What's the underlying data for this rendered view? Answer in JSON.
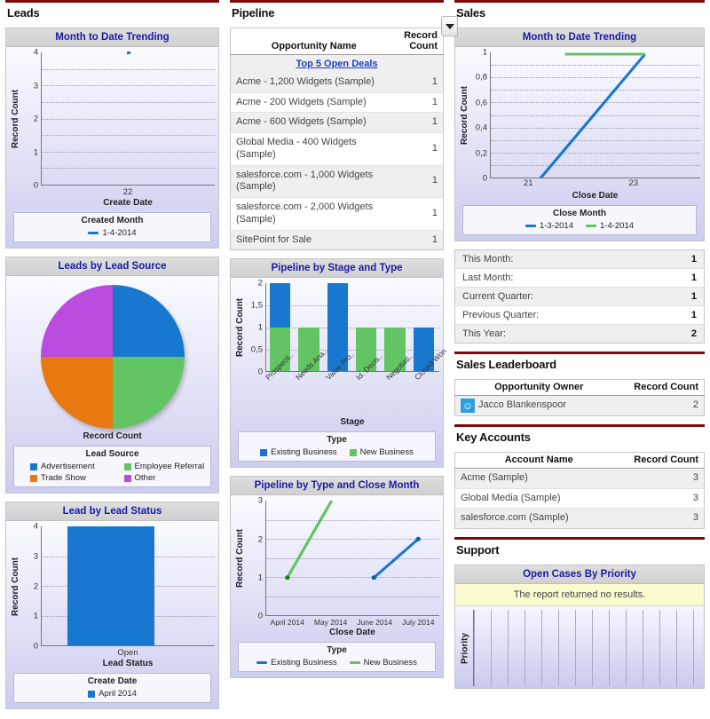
{
  "sections": {
    "leads": {
      "title": "Leads"
    },
    "pipeline": {
      "title": "Pipeline"
    },
    "sales": {
      "title": "Sales"
    },
    "leaderboard": {
      "title": "Sales Leaderboard"
    },
    "key_accounts": {
      "title": "Key Accounts"
    },
    "support": {
      "title": "Support"
    }
  },
  "colors": {
    "accent_red": "#7c0a0a",
    "title_blue": "#1a1aa8",
    "link_blue": "#1a3fc4",
    "series_blue": "#1878d0",
    "series_green": "#62c462",
    "series_orange": "#e8780f",
    "series_purple": "#bb4ce0"
  },
  "components": {
    "leads_mtd": {
      "title": "Month to Date Trending",
      "legend_title": "Created Month",
      "ylabel": "Record Count",
      "xlabel": "Create Date"
    },
    "leads_source": {
      "title": "Leads by Lead Source",
      "caption": "Record Count",
      "legend_title": "Lead Source"
    },
    "leads_status": {
      "title": "Lead by Lead Status",
      "legend_title": "Create Date",
      "ylabel": "Record Count",
      "xlabel": "Lead Status"
    },
    "top_deals": {
      "link_label": "Top 5 Open Deals",
      "columns": [
        "Opportunity Name",
        "Record Count"
      ]
    },
    "pipeline_stage": {
      "title": "Pipeline by Stage and Type",
      "legend_title": "Type",
      "ylabel": "Record Count",
      "xlabel": "Stage"
    },
    "pipeline_close": {
      "title": "Pipeline by Type and Close Month",
      "legend_title": "Type",
      "ylabel": "Record Count",
      "xlabel": "Close Date"
    },
    "sales_mtd": {
      "title": "Month to Date Trending",
      "legend_title": "Close Month",
      "ylabel": "Record Count",
      "xlabel": "Close Date"
    },
    "sales_metrics": {
      "rows": [
        {
          "label": "This Month:",
          "value": "1"
        },
        {
          "label": "Last Month:",
          "value": "1"
        },
        {
          "label": "Current Quarter:",
          "value": "1"
        },
        {
          "label": "Previous Quarter:",
          "value": "1"
        },
        {
          "label": "This Year:",
          "value": "2"
        }
      ]
    },
    "leaderboard": {
      "columns": [
        "Opportunity Owner",
        "Record Count"
      ],
      "rows": [
        {
          "owner": "Jacco Blankenspoor",
          "count": "2",
          "avatar_icon": "smiley-avatar-icon"
        }
      ]
    },
    "key_accounts": {
      "columns": [
        "Account Name",
        "Record Count"
      ],
      "rows": [
        {
          "name": "Acme (Sample)",
          "count": "3"
        },
        {
          "name": "Global Media (Sample)",
          "count": "3"
        },
        {
          "name": "salesforce.com (Sample)",
          "count": "3"
        }
      ]
    },
    "support": {
      "title": "Open Cases By Priority",
      "notice": "The report returned no results.",
      "ylabel": "Priority"
    }
  },
  "chart_data": [
    {
      "id": "leads_mtd",
      "type": "scatter",
      "title": "Month to Date Trending",
      "xlabel": "Create Date",
      "ylabel": "Record Count",
      "yticks": [
        "4",
        "3",
        "2",
        "1",
        "0"
      ],
      "ylim": [
        0,
        4
      ],
      "xticks": [
        "22"
      ],
      "grid": true,
      "legend_title": "Created Month",
      "legend_position": "bottom",
      "series": [
        {
          "name": "1-4-2014",
          "color": "#1878d0",
          "x": [
            22
          ],
          "values": [
            4
          ]
        }
      ]
    },
    {
      "id": "leads_source",
      "type": "pie",
      "title": "Leads by Lead Source",
      "caption": "Record Count",
      "legend_title": "Lead Source",
      "legend_position": "bottom",
      "labels": [
        "Advertisement",
        "Employee Referral",
        "Trade Show",
        "Other"
      ],
      "values": [
        1,
        1,
        1,
        1
      ],
      "percents": [
        25,
        25,
        25,
        25
      ],
      "colors": [
        "#1878d0",
        "#62c462",
        "#e8780f",
        "#bb4ce0"
      ]
    },
    {
      "id": "leads_status",
      "type": "bar",
      "title": "Lead by Lead Status",
      "xlabel": "Lead Status",
      "ylabel": "Record Count",
      "yticks": [
        "4",
        "3",
        "2",
        "1",
        "0"
      ],
      "ylim": [
        0,
        4
      ],
      "categories": [
        "Open"
      ],
      "grid": true,
      "legend_title": "Create Date",
      "legend_position": "bottom",
      "series": [
        {
          "name": "April 2014",
          "color": "#1878d0",
          "values": [
            4
          ]
        }
      ]
    },
    {
      "id": "top_deals",
      "type": "table",
      "title": "Top 5 Open Deals",
      "columns": [
        "Opportunity Name",
        "Record Count"
      ],
      "rows": [
        [
          "Acme - 1,200 Widgets (Sample)",
          "1"
        ],
        [
          "Acme - 200 Widgets (Sample)",
          "1"
        ],
        [
          "Acme - 600 Widgets (Sample)",
          "1"
        ],
        [
          "Global Media - 400 Widgets (Sample)",
          "1"
        ],
        [
          "salesforce.com - 1,000 Widgets (Sample)",
          "1"
        ],
        [
          "salesforce.com - 2,000 Widgets (Sample)",
          "1"
        ],
        [
          "SitePoint for Sale",
          "1"
        ]
      ]
    },
    {
      "id": "pipeline_stage",
      "type": "bar",
      "stacked": true,
      "title": "Pipeline by Stage and Type",
      "xlabel": "Stage",
      "ylabel": "Record Count",
      "yticks": [
        "2",
        "1,5",
        "1",
        "0,5",
        "0"
      ],
      "ylim": [
        0,
        2
      ],
      "grid": true,
      "categories": [
        "Prospecti..",
        "Needs Ana..",
        "Value Pro..",
        "Id. Decis..",
        "Negotiati..",
        "Closed Won"
      ],
      "legend_title": "Type",
      "legend_position": "bottom",
      "series": [
        {
          "name": "Existing Business",
          "color": "#1878d0",
          "values": [
            1,
            0,
            2,
            0,
            0,
            1
          ]
        },
        {
          "name": "New Business",
          "color": "#62c462",
          "values": [
            1,
            1,
            0,
            1,
            1,
            0
          ]
        }
      ]
    },
    {
      "id": "pipeline_close",
      "type": "line",
      "title": "Pipeline by Type and Close Month",
      "xlabel": "Close Date",
      "ylabel": "Record Count",
      "yticks": [
        "3",
        "2",
        "1",
        "0"
      ],
      "ylim": [
        0,
        3
      ],
      "grid": true,
      "categories": [
        "April 2014",
        "May 2014",
        "June 2014",
        "July 2014"
      ],
      "legend_title": "Type",
      "legend_position": "bottom",
      "series": [
        {
          "name": "Existing Business",
          "color": "#1878d0",
          "points": [
            [
              "June 2014",
              1
            ],
            [
              "July 2014",
              2
            ]
          ]
        },
        {
          "name": "New Business",
          "color": "#62c462",
          "points": [
            [
              "April 2014",
              1
            ],
            [
              "May 2014",
              3
            ]
          ]
        }
      ]
    },
    {
      "id": "sales_mtd",
      "type": "line",
      "title": "Month to Date Trending",
      "xlabel": "Close Date",
      "ylabel": "Record Count",
      "yticks": [
        "1",
        "0,8",
        "0,6",
        "0,4",
        "0,2",
        "0"
      ],
      "ylim": [
        0,
        1
      ],
      "xticks": [
        "21",
        "23"
      ],
      "grid": true,
      "legend_title": "Close Month",
      "legend_position": "bottom",
      "series": [
        {
          "name": "1-3-2014",
          "color": "#1878d0",
          "points": [
            [
              21,
              0
            ],
            [
              23,
              1
            ]
          ]
        },
        {
          "name": "1-4-2014",
          "color": "#62c462",
          "points": [
            [
              21.4,
              1
            ],
            [
              23,
              1
            ]
          ]
        }
      ]
    },
    {
      "id": "support_cases",
      "type": "bar",
      "title": "Open Cases By Priority",
      "ylabel": "Priority",
      "notice": "The report returned no results.",
      "categories": [],
      "values": [],
      "grid": true
    }
  ]
}
